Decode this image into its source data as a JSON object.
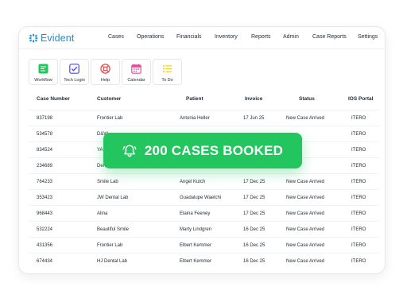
{
  "app": {
    "name": "Evident",
    "brand_color": "#1d8fd8"
  },
  "nav": {
    "items": [
      "Cases",
      "Operations",
      "Financials",
      "Inventory",
      "Reports",
      "Admin",
      "Case Reports",
      "Settings"
    ]
  },
  "quick_actions": [
    {
      "label": "Workflow",
      "icon": "workflow-icon",
      "color": "#22c55e"
    },
    {
      "label": "Tech Login",
      "icon": "checkbox-icon",
      "color": "#4f46e5"
    },
    {
      "label": "Help",
      "icon": "lifebuoy-icon",
      "color": "#ef4444"
    },
    {
      "label": "Calendar",
      "icon": "calendar-icon",
      "color": "#ec4899"
    },
    {
      "label": "To Do",
      "icon": "list-icon",
      "color": "#facc15"
    }
  ],
  "table": {
    "columns": [
      "Case Number",
      "Customer",
      "Patient",
      "Invoice",
      "Status",
      "IOS Portal"
    ],
    "rows": [
      [
        "837198",
        "Frontier Lab",
        "Antonia Heller",
        "17 Jun 25",
        "New Case Arrived",
        "ITERO"
      ],
      [
        "534578",
        "D&W",
        "",
        "",
        "",
        "ITERO"
      ],
      [
        "834524",
        "YA",
        "",
        "",
        "",
        "ITERO"
      ],
      [
        "234689",
        "Den",
        "",
        "",
        "",
        "ITERO"
      ],
      [
        "764233",
        "Smile Lab",
        "Angel Kutch",
        "17 Dec 25",
        "New Case Arrived",
        "ITERO"
      ],
      [
        "353423",
        "JW Dental Lab",
        "Guadalupe Waelchi",
        "17 Dec 25",
        "New Case Arrived",
        "ITERO"
      ],
      [
        "968443",
        "Alina",
        "Elaina Feeney",
        "17 Dec 25",
        "New Case Arrived",
        "ITERO"
      ],
      [
        "532224",
        "Beautiful Smile",
        "Marty Lindgren",
        "16 Dec 25",
        "New Case Arrived",
        "ITERO"
      ],
      [
        "431356",
        "Frontier Lab",
        "Elbert Kemmer",
        "16 Dec 25",
        "New Case Arrived",
        "ITERO"
      ],
      [
        "674434",
        "HJ Dental Lab",
        "Elbert Kemmer",
        "16 Dec 25",
        "New Case Arrived",
        "ITERO"
      ]
    ]
  },
  "toast": {
    "text": "200 CASES BOOKED",
    "icon": "bell-icon",
    "color": "#22c55e"
  }
}
